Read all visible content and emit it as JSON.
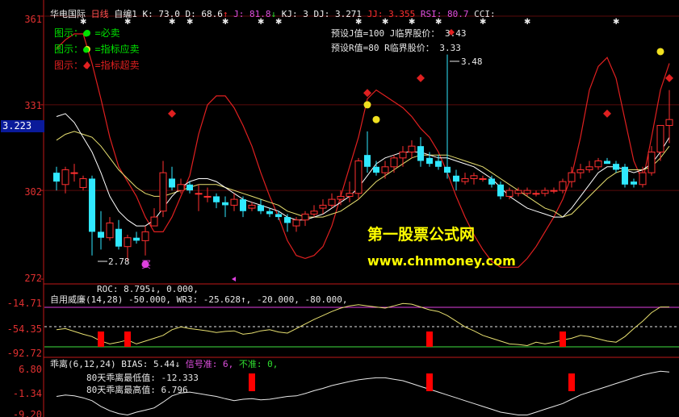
{
  "header": {
    "name": "华电国际",
    "period": "日线",
    "indicator_name": "自编1",
    "k": "K: 73.0",
    "d": "D: 68.6",
    "j": "J: 81.8",
    "kj": "KJ: 3",
    "dj": "DJ: 3.271",
    "jj": "JJ: 3.355",
    "rsi": "RSI: 80.7",
    "cci": "CCI:"
  },
  "legend": [
    {
      "text": "图示：● =必卖",
      "color": "#00e000"
    },
    {
      "text": "图示：● =指标应卖",
      "color": "#00e000"
    },
    {
      "text": "图示：◆ =指标超卖",
      "color": "#e02020"
    }
  ],
  "presets": {
    "line1": "预设J值=100 J临界股价： 3.43",
    "line2": "预设R值=80 R临界股价： 3.33"
  },
  "price_axis": {
    "ticks": [
      "361",
      "331",
      "302",
      "272"
    ],
    "current_price": "3.223"
  },
  "annotations": {
    "low": "2.78",
    "high": "3.48",
    "buy": "买"
  },
  "watermark": {
    "title": "第一股票公式网",
    "url": "www.chnmoney.com"
  },
  "panel2": {
    "roc_line": "ROC: 8.795↓, 0.000,",
    "title": "自用威廉(14,28)",
    "values": "-50.000, WR3: -25.628↑, -20.000, -80.000,",
    "ticks": [
      "-14.71",
      "-54.35",
      "-92.72"
    ]
  },
  "panel3": {
    "title": "乖离(6,12,24)",
    "bias": "BIAS: 5.44↓",
    "signal": "信号准: 6,",
    "invalid": "不准: 0,",
    "low_text": "80天乖离最低值: -12.333",
    "high_text": "80天乖离最高值: 6.796",
    "ticks": [
      "6.80",
      "-1.34",
      "-9.20"
    ]
  },
  "colors": {
    "up": "#ff3030",
    "down": "#30e8ff",
    "red_line": "#e02020",
    "white_line": "#ffffff",
    "yellow_line": "#e8e070",
    "magenta": "#e040e0",
    "green": "#40e040",
    "axis_red": "#c01818"
  },
  "chart_data": {
    "type": "candlestick",
    "candles": [
      {
        "o": 3.08,
        "h": 3.1,
        "l": 3.02,
        "c": 3.05
      },
      {
        "o": 3.04,
        "h": 3.1,
        "l": 3.01,
        "c": 3.09
      },
      {
        "o": 3.08,
        "h": 3.11,
        "l": 3.05,
        "c": 3.08
      },
      {
        "o": 3.03,
        "h": 3.07,
        "l": 3.02,
        "c": 3.06
      },
      {
        "o": 3.06,
        "h": 3.07,
        "l": 2.8,
        "c": 2.88
      },
      {
        "o": 2.88,
        "h": 2.95,
        "l": 2.82,
        "c": 2.86
      },
      {
        "o": 2.86,
        "h": 2.93,
        "l": 2.85,
        "c": 2.91
      },
      {
        "o": 2.89,
        "h": 2.92,
        "l": 2.82,
        "c": 2.83
      },
      {
        "o": 2.83,
        "h": 2.87,
        "l": 2.78,
        "c": 2.86
      },
      {
        "o": 2.86,
        "h": 2.88,
        "l": 2.84,
        "c": 2.85
      },
      {
        "o": 2.85,
        "h": 2.9,
        "l": 2.8,
        "c": 2.88
      },
      {
        "o": 2.9,
        "h": 2.96,
        "l": 2.9,
        "c": 2.93
      },
      {
        "o": 2.95,
        "h": 3.12,
        "l": 2.93,
        "c": 3.08
      },
      {
        "o": 3.06,
        "h": 3.1,
        "l": 3.02,
        "c": 3.03
      },
      {
        "o": 3.02,
        "h": 3.06,
        "l": 3.01,
        "c": 3.04
      },
      {
        "o": 3.04,
        "h": 3.05,
        "l": 3.01,
        "c": 3.02
      },
      {
        "o": 3.01,
        "h": 3.04,
        "l": 2.95,
        "c": 3.01
      },
      {
        "o": 3.0,
        "h": 3.03,
        "l": 2.98,
        "c": 3.0
      },
      {
        "o": 3.0,
        "h": 3.01,
        "l": 2.96,
        "c": 2.98
      },
      {
        "o": 2.98,
        "h": 3.0,
        "l": 2.93,
        "c": 2.97
      },
      {
        "o": 2.97,
        "h": 3.01,
        "l": 2.95,
        "c": 2.99
      },
      {
        "o": 2.99,
        "h": 3.0,
        "l": 2.93,
        "c": 2.95
      },
      {
        "o": 2.96,
        "h": 2.98,
        "l": 2.95,
        "c": 2.97
      },
      {
        "o": 2.97,
        "h": 2.99,
        "l": 2.94,
        "c": 2.95
      },
      {
        "o": 2.95,
        "h": 2.96,
        "l": 2.93,
        "c": 2.94
      },
      {
        "o": 2.94,
        "h": 2.95,
        "l": 2.92,
        "c": 2.93
      },
      {
        "o": 2.93,
        "h": 2.94,
        "l": 2.88,
        "c": 2.91
      },
      {
        "o": 2.9,
        "h": 2.93,
        "l": 2.88,
        "c": 2.92
      },
      {
        "o": 2.92,
        "h": 2.95,
        "l": 2.9,
        "c": 2.94
      },
      {
        "o": 2.94,
        "h": 2.97,
        "l": 2.93,
        "c": 2.95
      },
      {
        "o": 2.96,
        "h": 2.99,
        "l": 2.94,
        "c": 2.97
      },
      {
        "o": 2.97,
        "h": 3.01,
        "l": 2.96,
        "c": 2.99
      },
      {
        "o": 2.99,
        "h": 3.02,
        "l": 2.97,
        "c": 3.0
      },
      {
        "o": 3.0,
        "h": 3.05,
        "l": 2.98,
        "c": 3.01
      },
      {
        "o": 3.01,
        "h": 3.13,
        "l": 2.99,
        "c": 3.12
      },
      {
        "o": 3.14,
        "h": 3.22,
        "l": 3.08,
        "c": 3.1
      },
      {
        "o": 3.1,
        "h": 3.12,
        "l": 3.07,
        "c": 3.08
      },
      {
        "o": 3.08,
        "h": 3.12,
        "l": 3.06,
        "c": 3.1
      },
      {
        "o": 3.1,
        "h": 3.14,
        "l": 3.08,
        "c": 3.13
      },
      {
        "o": 3.13,
        "h": 3.17,
        "l": 3.1,
        "c": 3.15
      },
      {
        "o": 3.15,
        "h": 3.19,
        "l": 3.13,
        "c": 3.17
      },
      {
        "o": 3.17,
        "h": 3.2,
        "l": 3.1,
        "c": 3.12
      },
      {
        "o": 3.13,
        "h": 3.15,
        "l": 3.1,
        "c": 3.11
      },
      {
        "o": 3.12,
        "h": 3.14,
        "l": 3.09,
        "c": 3.1
      },
      {
        "o": 3.1,
        "h": 3.48,
        "l": 3.06,
        "c": 3.08
      },
      {
        "o": 3.07,
        "h": 3.09,
        "l": 3.02,
        "c": 3.05
      },
      {
        "o": 3.05,
        "h": 3.08,
        "l": 3.04,
        "c": 3.06
      },
      {
        "o": 3.06,
        "h": 3.08,
        "l": 3.04,
        "c": 3.07
      },
      {
        "o": 3.06,
        "h": 3.07,
        "l": 3.05,
        "c": 3.06
      },
      {
        "o": 3.06,
        "h": 3.07,
        "l": 3.03,
        "c": 3.04
      },
      {
        "o": 3.04,
        "h": 3.05,
        "l": 2.99,
        "c": 3.0
      },
      {
        "o": 3.0,
        "h": 3.03,
        "l": 2.99,
        "c": 3.02
      },
      {
        "o": 3.01,
        "h": 3.03,
        "l": 3.0,
        "c": 3.02
      },
      {
        "o": 3.01,
        "h": 3.03,
        "l": 3.0,
        "c": 3.02
      },
      {
        "o": 3.01,
        "h": 3.02,
        "l": 3.0,
        "c": 3.01
      },
      {
        "o": 3.01,
        "h": 3.03,
        "l": 3.0,
        "c": 3.02
      },
      {
        "o": 3.02,
        "h": 3.03,
        "l": 3.01,
        "c": 3.02
      },
      {
        "o": 3.02,
        "h": 3.06,
        "l": 3.01,
        "c": 3.05
      },
      {
        "o": 3.05,
        "h": 3.1,
        "l": 3.03,
        "c": 3.08
      },
      {
        "o": 3.08,
        "h": 3.11,
        "l": 3.06,
        "c": 3.09
      },
      {
        "o": 3.09,
        "h": 3.12,
        "l": 3.08,
        "c": 3.1
      },
      {
        "o": 3.1,
        "h": 3.13,
        "l": 3.09,
        "c": 3.12
      },
      {
        "o": 3.12,
        "h": 3.13,
        "l": 3.11,
        "c": 3.11
      },
      {
        "o": 3.11,
        "h": 3.12,
        "l": 3.08,
        "c": 3.09
      },
      {
        "o": 3.1,
        "h": 3.11,
        "l": 3.03,
        "c": 3.04
      },
      {
        "o": 3.05,
        "h": 3.06,
        "l": 3.03,
        "c": 3.04
      },
      {
        "o": 3.04,
        "h": 3.1,
        "l": 3.03,
        "c": 3.08
      },
      {
        "o": 3.08,
        "h": 3.17,
        "l": 3.07,
        "c": 3.15
      },
      {
        "o": 3.15,
        "h": 3.2,
        "l": 3.12,
        "c": 3.24
      },
      {
        "o": 3.24,
        "h": 3.36,
        "l": 3.18,
        "c": 3.26
      }
    ],
    "ma_white": [
      3.27,
      3.28,
      3.25,
      3.2,
      3.15,
      3.08,
      3.0,
      2.95,
      2.92,
      2.9,
      2.9,
      2.92,
      2.96,
      3.0,
      3.03,
      3.05,
      3.06,
      3.06,
      3.05,
      3.03,
      3.01,
      2.99,
      2.98,
      2.97,
      2.96,
      2.95,
      2.93,
      2.92,
      2.92,
      2.93,
      2.94,
      2.96,
      2.98,
      3.0,
      3.03,
      3.07,
      3.11,
      3.13,
      3.14,
      3.15,
      3.15,
      3.15,
      3.14,
      3.13,
      3.13,
      3.12,
      3.11,
      3.1,
      3.08,
      3.06,
      3.03,
      3.0,
      2.98,
      2.96,
      2.95,
      2.94,
      2.93,
      2.93,
      2.96,
      3.0,
      3.04,
      3.08,
      3.1,
      3.1,
      3.09,
      3.08,
      3.09,
      3.11,
      3.15,
      3.2
    ],
    "ma_yellow": [
      3.19,
      3.21,
      3.22,
      3.21,
      3.2,
      3.17,
      3.13,
      3.09,
      3.06,
      3.03,
      3.01,
      3.0,
      3.0,
      3.01,
      3.02,
      3.03,
      3.04,
      3.04,
      3.04,
      3.03,
      3.02,
      3.01,
      3.0,
      2.99,
      2.98,
      2.97,
      2.95,
      2.94,
      2.93,
      2.93,
      2.93,
      2.94,
      2.95,
      2.97,
      2.99,
      3.02,
      3.05,
      3.07,
      3.09,
      3.11,
      3.13,
      3.14,
      3.14,
      3.14,
      3.14,
      3.13,
      3.12,
      3.11,
      3.1,
      3.08,
      3.06,
      3.04,
      3.02,
      3.0,
      2.98,
      2.96,
      2.95,
      2.93,
      2.94,
      2.97,
      3.0,
      3.03,
      3.06,
      3.08,
      3.09,
      3.09,
      3.09,
      3.1,
      3.13,
      3.17
    ],
    "kdj_red": [
      3.5,
      3.53,
      3.55,
      3.55,
      3.45,
      3.33,
      3.2,
      3.1,
      3.05,
      3.0,
      2.93,
      2.88,
      2.88,
      2.93,
      3.0,
      3.07,
      3.21,
      3.31,
      3.34,
      3.34,
      3.3,
      3.24,
      3.17,
      3.08,
      3.0,
      2.93,
      2.85,
      2.8,
      2.79,
      2.8,
      2.83,
      2.9,
      3.0,
      3.1,
      3.2,
      3.33,
      3.36,
      3.34,
      3.32,
      3.3,
      3.27,
      3.23,
      3.2,
      3.15,
      3.08,
      3.0,
      2.93,
      2.87,
      2.82,
      2.78,
      2.76,
      2.76,
      2.76,
      2.79,
      2.83,
      2.88,
      2.93,
      2.99,
      3.07,
      3.2,
      3.36,
      3.44,
      3.47,
      3.4,
      3.26,
      3.12,
      3.05,
      3.2,
      3.36,
      3.45
    ],
    "ylim": [
      2.72,
      3.61
    ],
    "wr_line": [
      -60,
      -58,
      -63,
      -68,
      -72,
      -80,
      -85,
      -82,
      -78,
      -85,
      -80,
      -75,
      -70,
      -60,
      -55,
      -58,
      -60,
      -62,
      -65,
      -63,
      -62,
      -68,
      -66,
      -62,
      -60,
      -64,
      -66,
      -58,
      -50,
      -42,
      -35,
      -28,
      -22,
      -18,
      -16,
      -18,
      -20,
      -22,
      -18,
      -14,
      -15,
      -20,
      -25,
      -28,
      -35,
      -45,
      -55,
      -62,
      -70,
      -75,
      -80,
      -85,
      -86,
      -88,
      -82,
      -85,
      -82,
      -78,
      -75,
      -70,
      -72,
      -76,
      -80,
      -82,
      -72,
      -58,
      -45,
      -30,
      -20,
      -20
    ],
    "wr_ylim": [
      -100,
      -5
    ],
    "bias_line": [
      -2.0,
      -1.5,
      -1.8,
      -2.5,
      -3.5,
      -5.5,
      -7.0,
      -8.0,
      -8.5,
      -7.5,
      -6.8,
      -6.0,
      -4.0,
      -1.8,
      -0.8,
      -0.5,
      -1.0,
      -1.5,
      -2.0,
      -2.8,
      -3.5,
      -3.0,
      -2.8,
      -3.2,
      -3.0,
      -2.5,
      -2.0,
      -1.8,
      -1.0,
      0.0,
      0.8,
      1.8,
      2.5,
      3.2,
      3.8,
      4.2,
      4.5,
      4.5,
      4.0,
      3.5,
      2.5,
      1.5,
      0.5,
      -0.5,
      -1.5,
      -2.5,
      -3.5,
      -4.5,
      -5.5,
      -6.5,
      -7.5,
      -8.0,
      -8.5,
      -8.5,
      -7.5,
      -6.5,
      -5.5,
      -4.5,
      -3.0,
      -1.5,
      -0.5,
      0.5,
      1.5,
      2.5,
      3.5,
      4.5,
      5.5,
      6.2,
      6.8,
      6.5
    ],
    "bias_ylim": [
      -9.2,
      8.0
    ],
    "wr_signal_bars": [
      5,
      8,
      42,
      57
    ],
    "bias_signal_bars": [
      22,
      42,
      58
    ]
  }
}
